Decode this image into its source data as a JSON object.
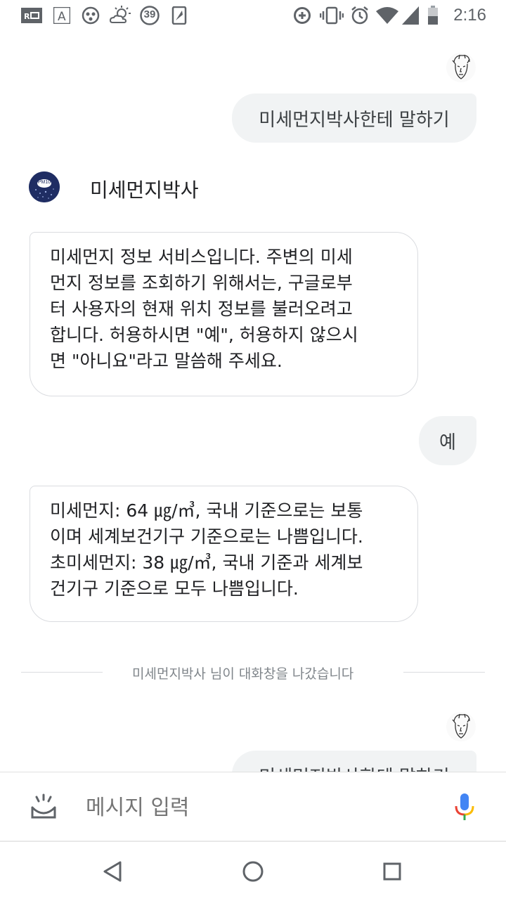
{
  "status_bar": {
    "time": "2:16",
    "notification_icons": [
      "rd-icon",
      "a-icon",
      "dots-circle-icon",
      "weather-icon",
      "badge-39-icon",
      "tablet-icon"
    ],
    "badge_number": "39",
    "system_icons": [
      "data-saver-icon",
      "vibrate-icon",
      "alarm-icon",
      "wifi-icon",
      "cell-signal-icon",
      "battery-icon"
    ]
  },
  "conversation": {
    "user_message_1": "미세먼지박사한테 말하기",
    "bot_name": "미세먼지박사",
    "bot_avatar_label": "PM10",
    "bot_message_1_lines": [
      "미세먼지 정보 서비스입니다. 주변의 미세",
      "먼지 정보를 조회하기 위해서는, 구글로부",
      "터 사용자의 현재 위치 정보를 불러오려고",
      "합니다. 허용하시면 \"예\", 허용하지 않으시",
      "면 \"아니요\"라고 말씀해 주세요."
    ],
    "user_message_2": "예",
    "bot_message_2_lines": [
      "미세먼지: 64 ㎍/㎥,  국내 기준으로는 보통",
      "이며 세계보건기구 기준으로는 나쁨입니다.",
      "초미세먼지: 38 ㎍/㎥,  국내 기준과 세계보",
      "건기구 기준으로 모두 나쁨입니다."
    ],
    "left_notice": "미세먼지박사 님이 대화창을 나갔습니다",
    "user_message_3": "미세먼지박사한테 말하기"
  },
  "input_bar": {
    "placeholder": "메시지 입력"
  },
  "colors": {
    "user_bubble": "#f1f3f4",
    "bot_border": "#dadce0",
    "mic_blue": "#4285f4",
    "mic_red": "#ea4335",
    "mic_yellow": "#fbbc05",
    "mic_green": "#34a853"
  }
}
